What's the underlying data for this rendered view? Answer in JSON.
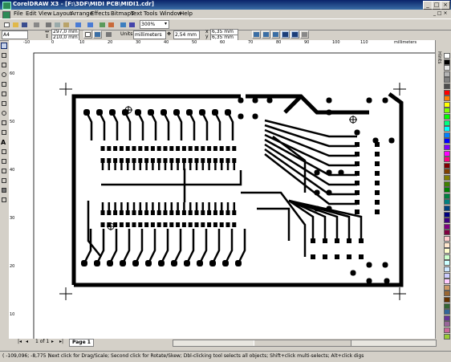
{
  "window": {
    "title": "CorelDRAW X3 - [F:\\3DF\\MIDI PCB\\MIDI1.cdr]"
  },
  "menu": [
    "File",
    "Edit",
    "View",
    "Layout",
    "Arrange",
    "Effects",
    "Bitmaps",
    "Text",
    "Tools",
    "Window",
    "Help"
  ],
  "toolbar": {
    "zoom": "300%"
  },
  "propbar": {
    "paper_size": "A4",
    "width": "297,0 mm",
    "height": "210,0 mm",
    "units_label": "Units:",
    "units_value": "millimeters",
    "nudge": "2,54 mm",
    "dup_x": "6,35 mm",
    "dup_y": "6,35 mm"
  },
  "rulers": {
    "top_unit": "millimeters",
    "top_ticks": [
      "-10",
      "0",
      "10",
      "20",
      "30",
      "40",
      "50",
      "60",
      "70",
      "80",
      "90",
      "100",
      "110"
    ],
    "left_ticks": [
      "60",
      "50",
      "40",
      "30",
      "20",
      "10"
    ]
  },
  "pages": {
    "count": "1 of 1",
    "tab": "Page 1"
  },
  "docker": {
    "label": "Hints"
  },
  "status": {
    "coords": "( -109,096; -8,775 )",
    "message": "Next click for Drag/Scale; Second click for Rotate/Skew; Dbl-clicking tool selects all objects; Shift+click multi-selects; Alt+click digs"
  },
  "palette": [
    "#ffffff",
    "#000000",
    "#e6e6e6",
    "#b3b3b3",
    "#808080",
    "#4d4d4d",
    "#ff0000",
    "#ff8000",
    "#ffff00",
    "#80ff00",
    "#00ff00",
    "#00ff80",
    "#00ffff",
    "#0080ff",
    "#0000ff",
    "#8000ff",
    "#ff00ff",
    "#ff0080",
    "#800000",
    "#804000",
    "#808000",
    "#408000",
    "#008000",
    "#008040",
    "#008080",
    "#004080",
    "#000080",
    "#400080",
    "#800080",
    "#800040",
    "#ffcccc",
    "#ffe6cc",
    "#ffffcc",
    "#ccffcc",
    "#ccffff",
    "#cce6ff",
    "#ccccff",
    "#ffccff",
    "#cc9966",
    "#996633",
    "#663300",
    "#336633",
    "#336699",
    "#663399",
    "#996699",
    "#cc6699",
    "#99cc33"
  ]
}
